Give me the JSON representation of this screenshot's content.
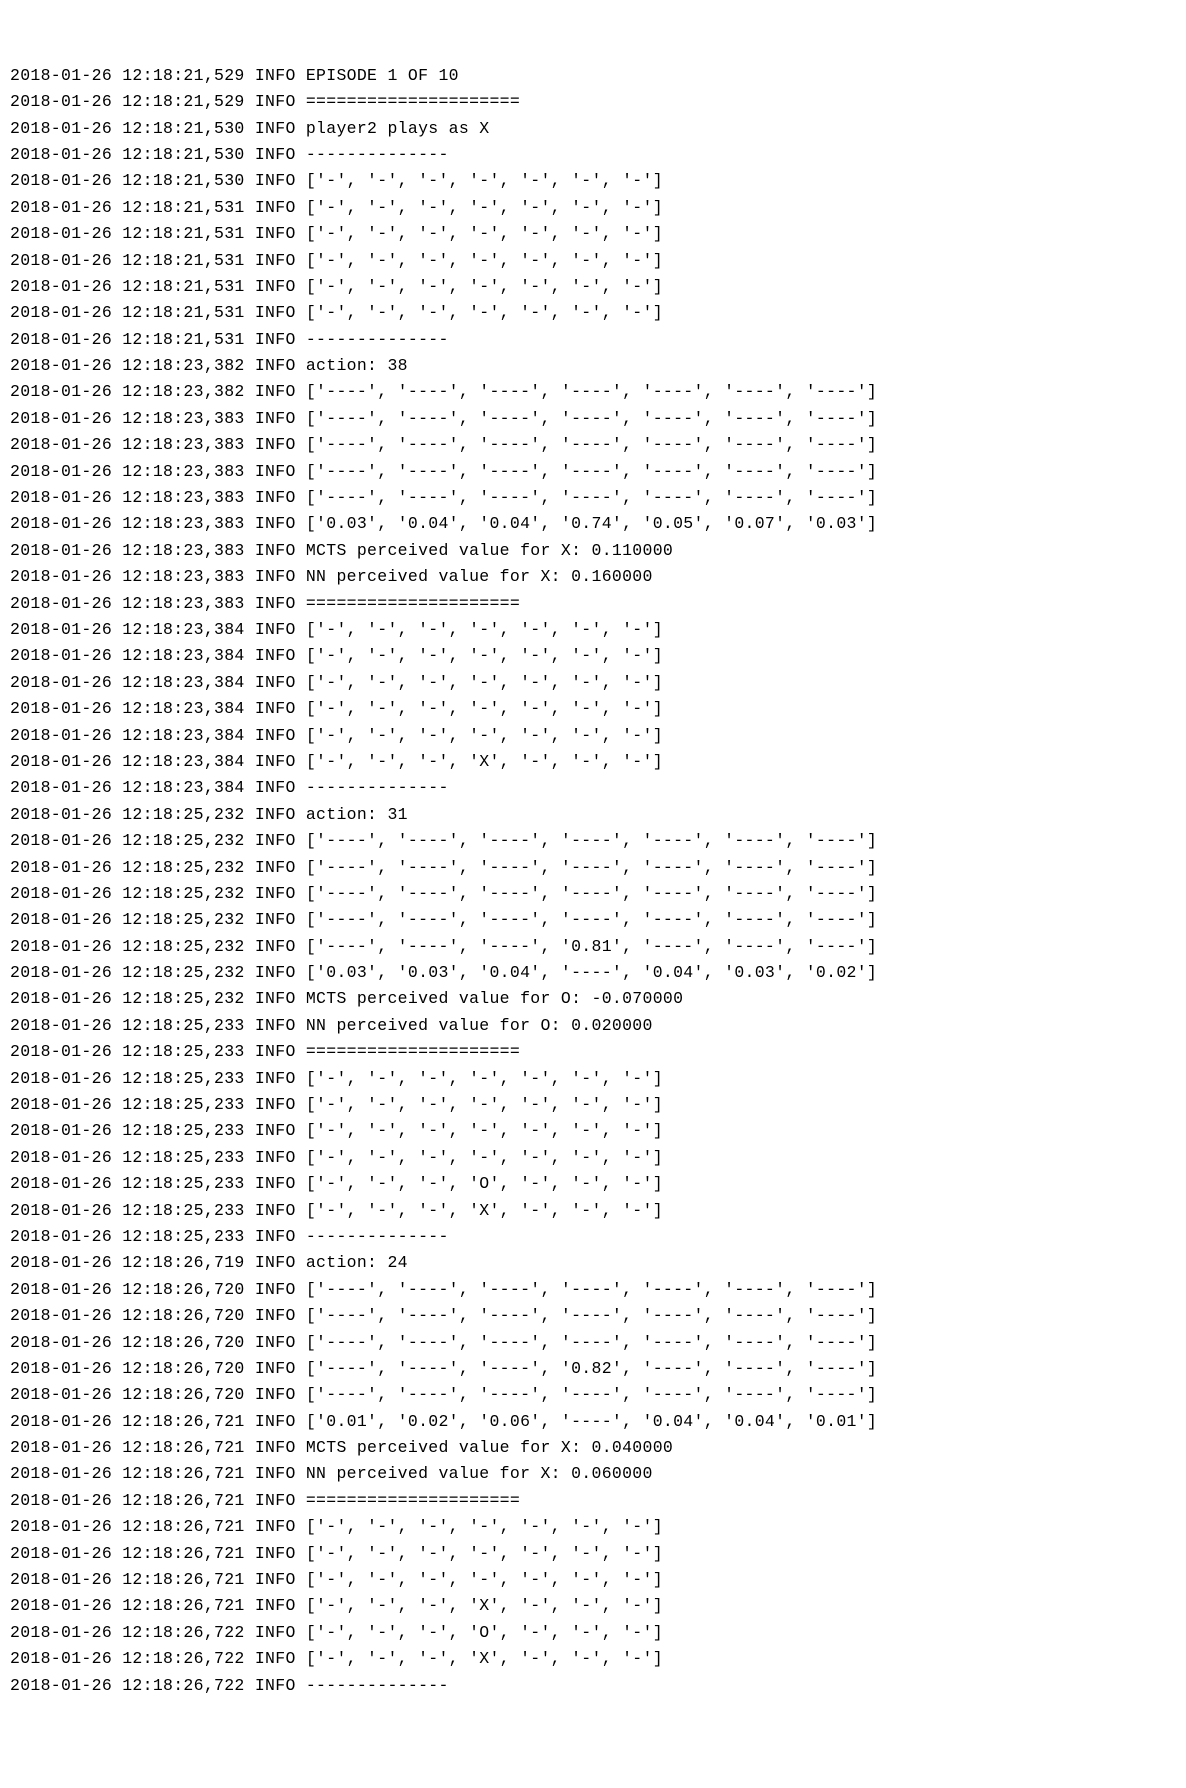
{
  "lines": [
    "2018-01-26 12:18:21,529 INFO EPISODE 1 OF 10",
    "2018-01-26 12:18:21,529 INFO =====================",
    "2018-01-26 12:18:21,530 INFO player2 plays as X",
    "2018-01-26 12:18:21,530 INFO --------------",
    "2018-01-26 12:18:21,530 INFO ['-', '-', '-', '-', '-', '-', '-']",
    "2018-01-26 12:18:21,531 INFO ['-', '-', '-', '-', '-', '-', '-']",
    "2018-01-26 12:18:21,531 INFO ['-', '-', '-', '-', '-', '-', '-']",
    "2018-01-26 12:18:21,531 INFO ['-', '-', '-', '-', '-', '-', '-']",
    "2018-01-26 12:18:21,531 INFO ['-', '-', '-', '-', '-', '-', '-']",
    "2018-01-26 12:18:21,531 INFO ['-', '-', '-', '-', '-', '-', '-']",
    "2018-01-26 12:18:21,531 INFO --------------",
    "2018-01-26 12:18:23,382 INFO action: 38",
    "2018-01-26 12:18:23,382 INFO ['----', '----', '----', '----', '----', '----', '----']",
    "2018-01-26 12:18:23,383 INFO ['----', '----', '----', '----', '----', '----', '----']",
    "2018-01-26 12:18:23,383 INFO ['----', '----', '----', '----', '----', '----', '----']",
    "2018-01-26 12:18:23,383 INFO ['----', '----', '----', '----', '----', '----', '----']",
    "2018-01-26 12:18:23,383 INFO ['----', '----', '----', '----', '----', '----', '----']",
    "2018-01-26 12:18:23,383 INFO ['0.03', '0.04', '0.04', '0.74', '0.05', '0.07', '0.03']",
    "2018-01-26 12:18:23,383 INFO MCTS perceived value for X: 0.110000",
    "2018-01-26 12:18:23,383 INFO NN perceived value for X: 0.160000",
    "2018-01-26 12:18:23,383 INFO =====================",
    "2018-01-26 12:18:23,384 INFO ['-', '-', '-', '-', '-', '-', '-']",
    "2018-01-26 12:18:23,384 INFO ['-', '-', '-', '-', '-', '-', '-']",
    "2018-01-26 12:18:23,384 INFO ['-', '-', '-', '-', '-', '-', '-']",
    "2018-01-26 12:18:23,384 INFO ['-', '-', '-', '-', '-', '-', '-']",
    "2018-01-26 12:18:23,384 INFO ['-', '-', '-', '-', '-', '-', '-']",
    "2018-01-26 12:18:23,384 INFO ['-', '-', '-', 'X', '-', '-', '-']",
    "2018-01-26 12:18:23,384 INFO --------------",
    "2018-01-26 12:18:25,232 INFO action: 31",
    "2018-01-26 12:18:25,232 INFO ['----', '----', '----', '----', '----', '----', '----']",
    "2018-01-26 12:18:25,232 INFO ['----', '----', '----', '----', '----', '----', '----']",
    "2018-01-26 12:18:25,232 INFO ['----', '----', '----', '----', '----', '----', '----']",
    "2018-01-26 12:18:25,232 INFO ['----', '----', '----', '----', '----', '----', '----']",
    "2018-01-26 12:18:25,232 INFO ['----', '----', '----', '0.81', '----', '----', '----']",
    "2018-01-26 12:18:25,232 INFO ['0.03', '0.03', '0.04', '----', '0.04', '0.03', '0.02']",
    "2018-01-26 12:18:25,232 INFO MCTS perceived value for O: -0.070000",
    "2018-01-26 12:18:25,233 INFO NN perceived value for O: 0.020000",
    "2018-01-26 12:18:25,233 INFO =====================",
    "2018-01-26 12:18:25,233 INFO ['-', '-', '-', '-', '-', '-', '-']",
    "2018-01-26 12:18:25,233 INFO ['-', '-', '-', '-', '-', '-', '-']",
    "2018-01-26 12:18:25,233 INFO ['-', '-', '-', '-', '-', '-', '-']",
    "2018-01-26 12:18:25,233 INFO ['-', '-', '-', '-', '-', '-', '-']",
    "2018-01-26 12:18:25,233 INFO ['-', '-', '-', 'O', '-', '-', '-']",
    "2018-01-26 12:18:25,233 INFO ['-', '-', '-', 'X', '-', '-', '-']",
    "2018-01-26 12:18:25,233 INFO --------------",
    "2018-01-26 12:18:26,719 INFO action: 24",
    "2018-01-26 12:18:26,720 INFO ['----', '----', '----', '----', '----', '----', '----']",
    "2018-01-26 12:18:26,720 INFO ['----', '----', '----', '----', '----', '----', '----']",
    "2018-01-26 12:18:26,720 INFO ['----', '----', '----', '----', '----', '----', '----']",
    "2018-01-26 12:18:26,720 INFO ['----', '----', '----', '0.82', '----', '----', '----']",
    "2018-01-26 12:18:26,720 INFO ['----', '----', '----', '----', '----', '----', '----']",
    "2018-01-26 12:18:26,721 INFO ['0.01', '0.02', '0.06', '----', '0.04', '0.04', '0.01']",
    "2018-01-26 12:18:26,721 INFO MCTS perceived value for X: 0.040000",
    "2018-01-26 12:18:26,721 INFO NN perceived value for X: 0.060000",
    "2018-01-26 12:18:26,721 INFO =====================",
    "2018-01-26 12:18:26,721 INFO ['-', '-', '-', '-', '-', '-', '-']",
    "2018-01-26 12:18:26,721 INFO ['-', '-', '-', '-', '-', '-', '-']",
    "2018-01-26 12:18:26,721 INFO ['-', '-', '-', '-', '-', '-', '-']",
    "2018-01-26 12:18:26,721 INFO ['-', '-', '-', 'X', '-', '-', '-']",
    "2018-01-26 12:18:26,722 INFO ['-', '-', '-', 'O', '-', '-', '-']",
    "2018-01-26 12:18:26,722 INFO ['-', '-', '-', 'X', '-', '-', '-']",
    "2018-01-26 12:18:26,722 INFO --------------"
  ]
}
